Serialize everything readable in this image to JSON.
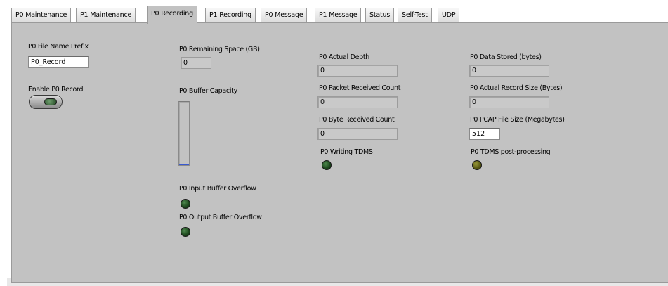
{
  "tabs": [
    {
      "label": "P0 Maintenance",
      "active": false
    },
    {
      "label": "P1 Maintenance",
      "active": false
    },
    {
      "label": "P0 Recording",
      "active": true
    },
    {
      "label": "P1 Recording",
      "active": false
    },
    {
      "label": "P0 Message",
      "active": false
    },
    {
      "label": "P1 Message",
      "active": false
    },
    {
      "label": "Status",
      "active": false
    },
    {
      "label": "Self-Test",
      "active": false
    },
    {
      "label": "UDP",
      "active": false
    }
  ],
  "recording": {
    "file_prefix": {
      "label": "P0 File Name Prefix",
      "value": "P0_Record"
    },
    "enable_record": {
      "label": "Enable P0 Record",
      "state": "off"
    },
    "remaining_space": {
      "label": "P0 Remaining Space (GB)",
      "value": "0"
    },
    "buffer_capacity": {
      "label": "P0 Buffer Capacity",
      "level": 0
    },
    "input_overflow": {
      "label": "P0 Input Buffer Overflow",
      "state": "off"
    },
    "output_overflow": {
      "label": "P0 Output Buffer Overflow",
      "state": "off"
    },
    "actual_depth": {
      "label": "P0 Actual Depth",
      "value": "0"
    },
    "packet_count": {
      "label": "P0 Packet Received Count",
      "value": "0"
    },
    "byte_count": {
      "label": "P0 Byte Received Count",
      "value": "0"
    },
    "writing_tdms": {
      "label": "P0 Writing TDMS",
      "state": "off"
    },
    "data_stored": {
      "label": "P0 Data Stored (bytes)",
      "value": "0"
    },
    "actual_record_size": {
      "label": "P0 Actual Record Size (Bytes)",
      "value": "0"
    },
    "pcap_size": {
      "label": "P0 PCAP File Size (Megabytes)",
      "value": "512"
    },
    "tdms_post": {
      "label": "P0 TDMS post-processing",
      "state": "olive"
    }
  },
  "colors": {
    "panel": "#c2c2c2",
    "led_off": "#1f4a1f",
    "led_olive": "#5a5a14",
    "buffer_fill": "#3a5ad0"
  },
  "icons": {
    "led": "round-led-indicator",
    "toggle": "slide-toggle-switch"
  }
}
